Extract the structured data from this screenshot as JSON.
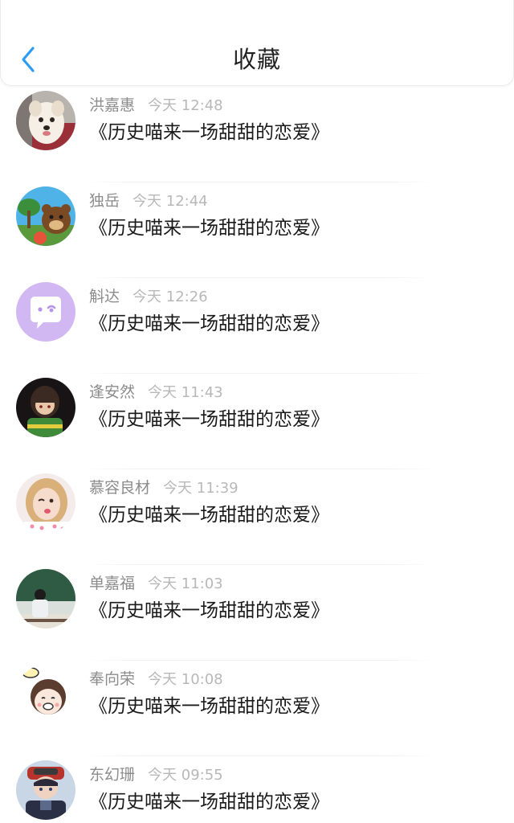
{
  "header": {
    "title": "收藏",
    "back_icon": "chevron-left-icon",
    "accent_color": "#2a9df4"
  },
  "items": [
    {
      "name": "洪嘉惠",
      "time": "今天 12:48",
      "title": "《历史喵来一场甜甜的恋爱》",
      "avatar": "avatar-dog"
    },
    {
      "name": "独岳",
      "time": "今天 12:44",
      "title": "《历史喵来一场甜甜的恋爱》",
      "avatar": "avatar-bear-cartoon"
    },
    {
      "name": "斛达",
      "time": "今天 12:26",
      "title": "《历史喵来一场甜甜的恋爱》",
      "avatar": "avatar-chat-bubble"
    },
    {
      "name": "逢安然",
      "time": "今天 11:43",
      "title": "《历史喵来一场甜甜的恋爱》",
      "avatar": "avatar-game-character"
    },
    {
      "name": "慕容良材",
      "time": "今天 11:39",
      "title": "《历史喵来一场甜甜的恋爱》",
      "avatar": "avatar-girl-photo"
    },
    {
      "name": "单嘉福",
      "time": "今天 11:03",
      "title": "《历史喵来一场甜甜的恋爱》",
      "avatar": "avatar-classroom"
    },
    {
      "name": "奉向荣",
      "time": "今天 10:08",
      "title": "《历史喵来一场甜甜的恋爱》",
      "avatar": "avatar-cartoon-girl"
    },
    {
      "name": "东幻珊",
      "time": "今天 09:55",
      "title": "《历史喵来一场甜甜的恋爱》",
      "avatar": "avatar-anime-boy"
    }
  ]
}
